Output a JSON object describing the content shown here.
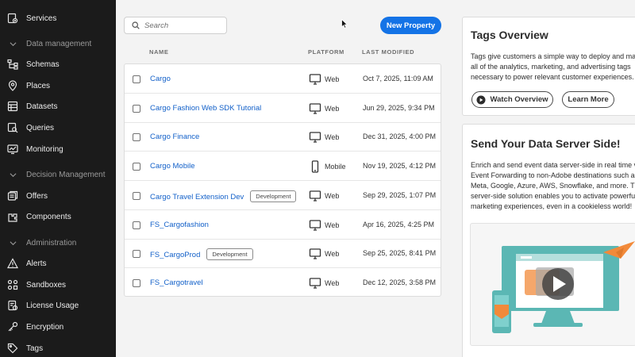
{
  "sidebar": {
    "top_item": {
      "label": "Services",
      "icon": "services-icon"
    },
    "sections": [
      {
        "label": "Data management"
      },
      {
        "label": "Decision Management"
      },
      {
        "label": "Administration"
      }
    ],
    "items": [
      {
        "label": "Schemas",
        "icon": "schemas-icon"
      },
      {
        "label": "Places",
        "icon": "places-icon"
      },
      {
        "label": "Datasets",
        "icon": "datasets-icon"
      },
      {
        "label": "Queries",
        "icon": "queries-icon"
      },
      {
        "label": "Monitoring",
        "icon": "monitoring-icon"
      },
      {
        "label": "Offers",
        "icon": "offers-icon"
      },
      {
        "label": "Components",
        "icon": "components-icon"
      },
      {
        "label": "Alerts",
        "icon": "alerts-icon"
      },
      {
        "label": "Sandboxes",
        "icon": "sandboxes-icon"
      },
      {
        "label": "License Usage",
        "icon": "license-usage-icon"
      },
      {
        "label": "Encryption",
        "icon": "encryption-icon"
      },
      {
        "label": "Tags",
        "icon": "tags-icon"
      }
    ]
  },
  "toolbar": {
    "search_placeholder": "Search",
    "new_property_label": "New Property"
  },
  "table": {
    "headers": {
      "name": "NAME",
      "platform": "PLATFORM",
      "modified": "LAST MODIFIED"
    },
    "rows": [
      {
        "name": "Cargo",
        "badge": "",
        "platform": "Web",
        "modified": "Oct 7, 2025, 11:09 AM"
      },
      {
        "name": "Cargo Fashion Web SDK Tutorial",
        "badge": "",
        "platform": "Web",
        "modified": "Jun 29, 2025, 9:34 PM"
      },
      {
        "name": "Cargo Finance",
        "badge": "",
        "platform": "Web",
        "modified": "Dec 31, 2025, 4:00 PM"
      },
      {
        "name": "Cargo Mobile",
        "badge": "",
        "platform": "Mobile",
        "modified": "Nov 19, 2025, 4:12 PM"
      },
      {
        "name": "Cargo Travel Extension Dev",
        "badge": "Development",
        "platform": "Web",
        "modified": "Sep 29, 2025, 1:07 PM"
      },
      {
        "name": "FS_Cargofashion",
        "badge": "",
        "platform": "Web",
        "modified": "Apr 16, 2025, 4:25 PM"
      },
      {
        "name": "FS_CargoProd",
        "badge": "Development",
        "platform": "Web",
        "modified": "Sep 25, 2025, 8:41 PM"
      },
      {
        "name": "FS_Cargotravel",
        "badge": "",
        "platform": "Web",
        "modified": "Dec 12, 2025, 3:58 PM"
      }
    ]
  },
  "overview": {
    "title": "Tags Overview",
    "lines": [
      "Tags give customers a simple way to deploy and man",
      "all of the analytics, marketing, and advertising tags",
      "necessary to power relevant customer experiences."
    ],
    "watch_label": "Watch Overview",
    "learn_label": "Learn More"
  },
  "server_side": {
    "title": "Send Your Data Server Side!",
    "lines": [
      "Enrich and send event data server-side in real time vi",
      "Event Forwarding to non-Adobe destinations such as",
      "Meta, Google, Azure, AWS, Snowflake, and more. This",
      "server-side solution enables you to activate powerful",
      "marketing experiences, even in a cookieless world!"
    ]
  },
  "colors": {
    "accent": "#1473e6",
    "link": "#1260c9",
    "sidebar_bg": "#1b1b1b",
    "teal": "#5bb7b4",
    "orange": "#f28a3a"
  }
}
